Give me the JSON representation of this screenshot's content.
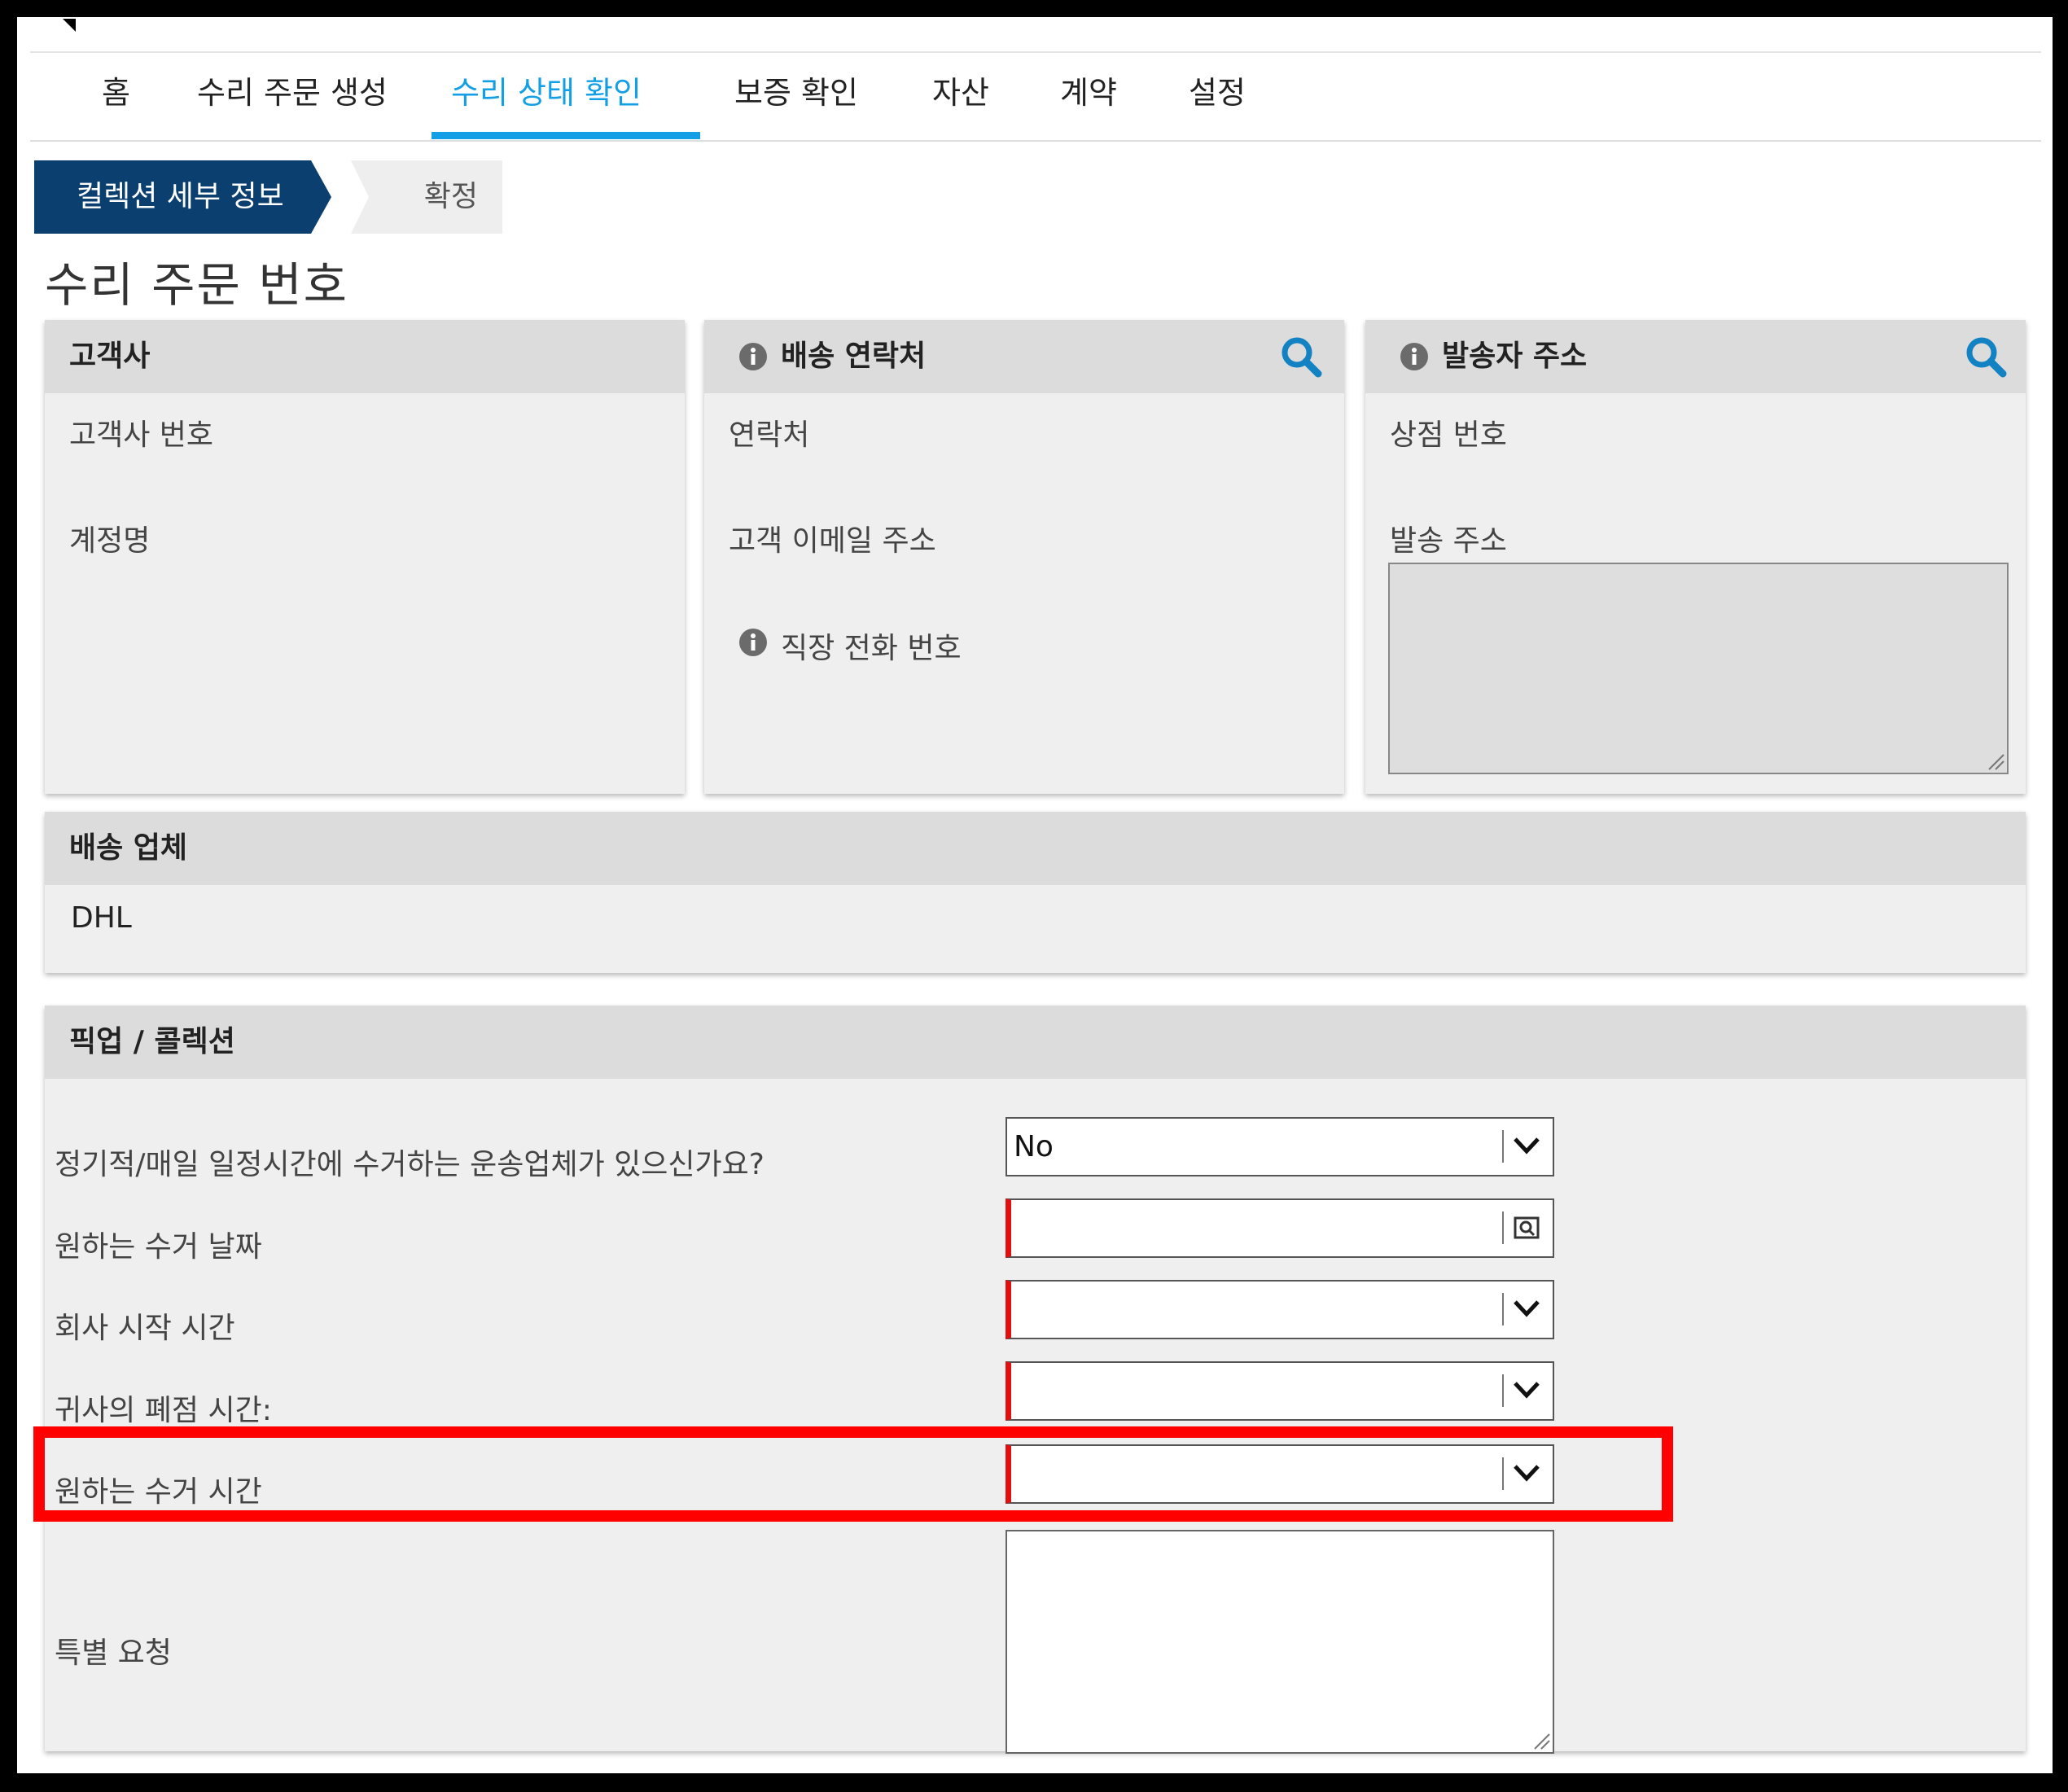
{
  "nav": {
    "items": [
      "홈",
      "수리 주문 생성",
      "수리 상태 확인",
      "보증 확인",
      "자산",
      "계약",
      "설정"
    ],
    "active_index": 2,
    "accent_color": "#139fe6"
  },
  "steps": {
    "current": "컬렉션 세부 정보",
    "next": "확정",
    "current_color": "#0b3f70"
  },
  "page_title": "수리 주문 번호",
  "panels": {
    "customer": {
      "title": "고객사",
      "fields": [
        "고객사 번호",
        "계정명"
      ]
    },
    "shipping_contact": {
      "title": "배송 연락처",
      "fields": [
        "연락처",
        "고객 이메일 주소",
        "직장 전화 번호"
      ],
      "icons": [
        "info-icon",
        "search-icon"
      ]
    },
    "sender_address": {
      "title": "발송자 주소",
      "fields": [
        "상점 번호",
        "발송 주소"
      ],
      "icons": [
        "info-icon",
        "search-icon"
      ]
    },
    "carrier": {
      "title": "배송 업체",
      "value": "DHL"
    },
    "pickup": {
      "title": "픽업 / 콜렉션",
      "fields": [
        {
          "label": "정기적/매일 일정시간에 수거하는 운송업체가 있으신가요?",
          "value": "No",
          "control": "select"
        },
        {
          "label": "원하는 수거 날짜",
          "value": "",
          "control": "date"
        },
        {
          "label": "회사 시작 시간",
          "value": "",
          "control": "select"
        },
        {
          "label": "귀사의 폐점 시간:",
          "value": "",
          "control": "select"
        },
        {
          "label": "원하는 수거 시간",
          "value": "",
          "control": "select"
        }
      ],
      "special_request_label": "특별 요청",
      "required_color": "#e01010",
      "highlight_color": "#ff0000"
    }
  }
}
